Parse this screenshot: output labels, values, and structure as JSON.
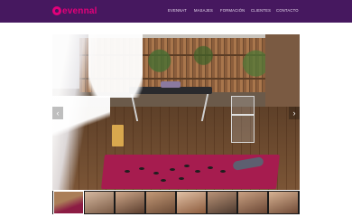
{
  "header": {
    "logo_text": "evennal",
    "nav": [
      "EVENNAT",
      "MASAJES",
      "FORMACIÓN",
      "CLIENTES",
      "CONTACTO"
    ]
  },
  "slider": {
    "prev_icon": "chevron-left-icon",
    "next_icon": "chevron-right-icon",
    "prev_glyph": "‹",
    "next_glyph": "›"
  },
  "thumbnails": {
    "count": 8,
    "active_index": 0
  },
  "colors": {
    "header_bg": "#46185f",
    "brand_magenta": "#e2007a",
    "mat": "#a61c4f"
  }
}
